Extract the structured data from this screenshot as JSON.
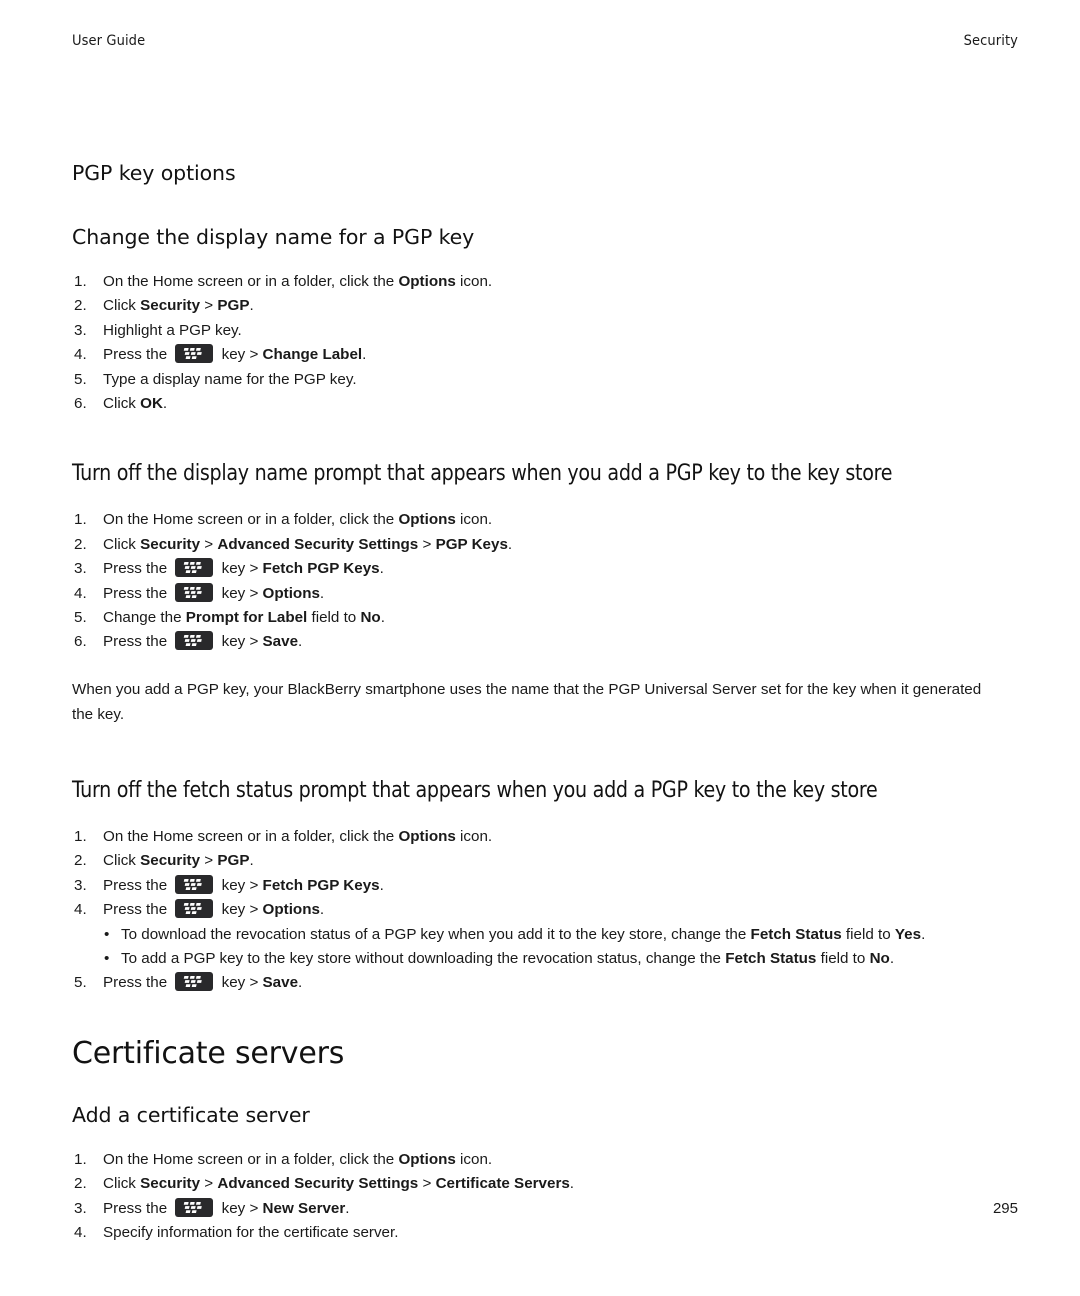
{
  "header": {
    "left": "User Guide",
    "right": "Security"
  },
  "icons": {
    "menu_key": "blackberry-menu-key-icon"
  },
  "sections": [
    {
      "id": "pgp-key-options",
      "heading": "PGP key options",
      "level": "mid"
    },
    {
      "id": "change-display-name",
      "heading": "Change the display name for a PGP key",
      "level": "mid",
      "steps": [
        {
          "num": "1.",
          "parts": [
            {
              "t": "On the Home screen or in a folder, click the "
            },
            {
              "t": "Options",
              "b": true
            },
            {
              "t": " icon."
            }
          ]
        },
        {
          "num": "2.",
          "parts": [
            {
              "t": "Click "
            },
            {
              "t": "Security",
              "b": true
            },
            {
              "t": " > "
            },
            {
              "t": "PGP",
              "b": true
            },
            {
              "t": "."
            }
          ]
        },
        {
          "num": "3.",
          "parts": [
            {
              "t": "Highlight a PGP key."
            }
          ]
        },
        {
          "num": "4.",
          "parts": [
            {
              "t": "Press the "
            },
            {
              "icon": "menu-key"
            },
            {
              "t": " key > "
            },
            {
              "t": "Change Label",
              "b": true
            },
            {
              "t": "."
            }
          ]
        },
        {
          "num": "5.",
          "parts": [
            {
              "t": "Type a display name for the PGP key."
            }
          ]
        },
        {
          "num": "6.",
          "parts": [
            {
              "t": "Click "
            },
            {
              "t": "OK",
              "b": true
            },
            {
              "t": "."
            }
          ]
        }
      ]
    },
    {
      "id": "turn-off-display-name-prompt",
      "heading": "Turn off the display name prompt that appears when you add a PGP key to the key store",
      "level": "wide",
      "steps": [
        {
          "num": "1.",
          "parts": [
            {
              "t": "On the Home screen or in a folder, click the "
            },
            {
              "t": "Options",
              "b": true
            },
            {
              "t": " icon."
            }
          ]
        },
        {
          "num": "2.",
          "parts": [
            {
              "t": "Click "
            },
            {
              "t": "Security",
              "b": true
            },
            {
              "t": " > "
            },
            {
              "t": "Advanced Security Settings",
              "b": true
            },
            {
              "t": " > "
            },
            {
              "t": "PGP Keys",
              "b": true
            },
            {
              "t": "."
            }
          ]
        },
        {
          "num": "3.",
          "parts": [
            {
              "t": "Press the "
            },
            {
              "icon": "menu-key"
            },
            {
              "t": " key > "
            },
            {
              "t": "Fetch PGP Keys",
              "b": true
            },
            {
              "t": "."
            }
          ]
        },
        {
          "num": "4.",
          "parts": [
            {
              "t": "Press the "
            },
            {
              "icon": "menu-key"
            },
            {
              "t": " key > "
            },
            {
              "t": "Options",
              "b": true
            },
            {
              "t": "."
            }
          ]
        },
        {
          "num": "5.",
          "parts": [
            {
              "t": "Change the "
            },
            {
              "t": "Prompt for Label",
              "b": true
            },
            {
              "t": " field to "
            },
            {
              "t": "No",
              "b": true
            },
            {
              "t": "."
            }
          ]
        },
        {
          "num": "6.",
          "parts": [
            {
              "t": "Press the "
            },
            {
              "icon": "menu-key"
            },
            {
              "t": " key > "
            },
            {
              "t": "Save",
              "b": true
            },
            {
              "t": "."
            }
          ]
        }
      ],
      "paragraph": "When you add a PGP key, your BlackBerry smartphone uses the name that the PGP Universal Server set for the key when it generated the key."
    },
    {
      "id": "turn-off-fetch-status-prompt",
      "heading": "Turn off the fetch status prompt that appears when you add a PGP key to the key store",
      "level": "wide",
      "steps": [
        {
          "num": "1.",
          "parts": [
            {
              "t": "On the Home screen or in a folder, click the "
            },
            {
              "t": "Options",
              "b": true
            },
            {
              "t": " icon."
            }
          ]
        },
        {
          "num": "2.",
          "parts": [
            {
              "t": "Click "
            },
            {
              "t": "Security",
              "b": true
            },
            {
              "t": " > "
            },
            {
              "t": "PGP",
              "b": true
            },
            {
              "t": "."
            }
          ]
        },
        {
          "num": "3.",
          "parts": [
            {
              "t": "Press the "
            },
            {
              "icon": "menu-key"
            },
            {
              "t": " key > "
            },
            {
              "t": "Fetch PGP Keys",
              "b": true
            },
            {
              "t": "."
            }
          ]
        },
        {
          "num": "4.",
          "parts": [
            {
              "t": "Press the "
            },
            {
              "icon": "menu-key"
            },
            {
              "t": " key > "
            },
            {
              "t": "Options",
              "b": true
            },
            {
              "t": "."
            }
          ]
        }
      ],
      "bullets": [
        {
          "bullet": "•",
          "parts": [
            {
              "t": "To download the revocation status of a PGP key when you add it to the key store, change the "
            },
            {
              "t": "Fetch Status",
              "b": true
            },
            {
              "t": " field to "
            },
            {
              "t": "Yes",
              "b": true
            },
            {
              "t": "."
            }
          ]
        },
        {
          "bullet": "•",
          "parts": [
            {
              "t": "To add a PGP key to the key store without downloading the revocation status, change the "
            },
            {
              "t": "Fetch Status",
              "b": true
            },
            {
              "t": " field to "
            },
            {
              "t": "No",
              "b": true
            },
            {
              "t": "."
            }
          ]
        }
      ],
      "steps_after": [
        {
          "num": "5.",
          "parts": [
            {
              "t": "Press the "
            },
            {
              "icon": "menu-key"
            },
            {
              "t": " key > "
            },
            {
              "t": "Save",
              "b": true
            },
            {
              "t": "."
            }
          ]
        }
      ]
    },
    {
      "id": "certificate-servers",
      "heading": "Certificate servers",
      "level": "big"
    },
    {
      "id": "add-a-certificate-server",
      "heading": "Add a certificate server",
      "level": "mid",
      "steps": [
        {
          "num": "1.",
          "parts": [
            {
              "t": "On the Home screen or in a folder, click the "
            },
            {
              "t": "Options",
              "b": true
            },
            {
              "t": " icon."
            }
          ]
        },
        {
          "num": "2.",
          "parts": [
            {
              "t": "Click "
            },
            {
              "t": "Security",
              "b": true
            },
            {
              "t": " > "
            },
            {
              "t": "Advanced Security Settings",
              "b": true
            },
            {
              "t": " > "
            },
            {
              "t": "Certificate Servers",
              "b": true
            },
            {
              "t": "."
            }
          ]
        },
        {
          "num": "3.",
          "parts": [
            {
              "t": "Press the "
            },
            {
              "icon": "menu-key"
            },
            {
              "t": " key > "
            },
            {
              "t": "New Server",
              "b": true
            },
            {
              "t": "."
            }
          ]
        },
        {
          "num": "4.",
          "parts": [
            {
              "t": "Specify information for the certificate server."
            }
          ]
        }
      ]
    }
  ],
  "footer": {
    "page_number": "295"
  },
  "colors": {
    "text": "#1a1a1a",
    "heading": "#121212",
    "key_icon_bg": "#29292b",
    "page_bg": "#ffffff"
  }
}
